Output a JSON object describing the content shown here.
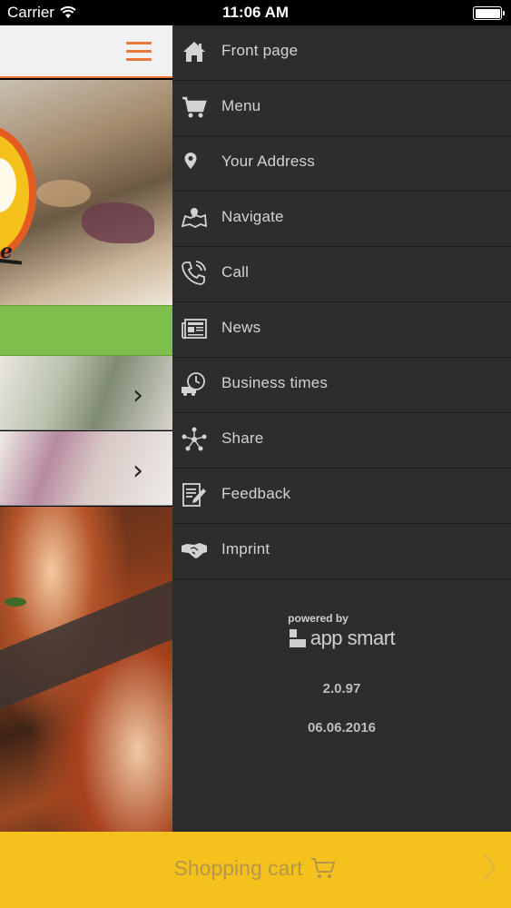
{
  "status_bar": {
    "carrier": "Carrier",
    "time": "11:06 AM"
  },
  "colors": {
    "accent": "#e9773a",
    "menu_bg": "#2c2d2f",
    "cart_bar": "#f5c11c",
    "green_bar": "#7ec04b"
  },
  "side_menu": {
    "items": [
      {
        "label": "Front page",
        "icon": "home-icon"
      },
      {
        "label": "Menu",
        "icon": "shopping-cart-icon"
      },
      {
        "label": "Your Address",
        "icon": "location-pin-icon"
      },
      {
        "label": "Navigate",
        "icon": "map-icon"
      },
      {
        "label": "Call",
        "icon": "phone-icon"
      },
      {
        "label": "News",
        "icon": "newspaper-icon"
      },
      {
        "label": "Business times",
        "icon": "clock-truck-icon"
      },
      {
        "label": "Share",
        "icon": "share-icon"
      },
      {
        "label": "Feedback",
        "icon": "feedback-icon"
      },
      {
        "label": "Imprint",
        "icon": "handshake-icon"
      }
    ],
    "powered_by": "powered by",
    "brand": "app smart",
    "version": "2.0.97",
    "date": "06.06.2016"
  },
  "cart_bar": {
    "label": "Shopping cart"
  }
}
